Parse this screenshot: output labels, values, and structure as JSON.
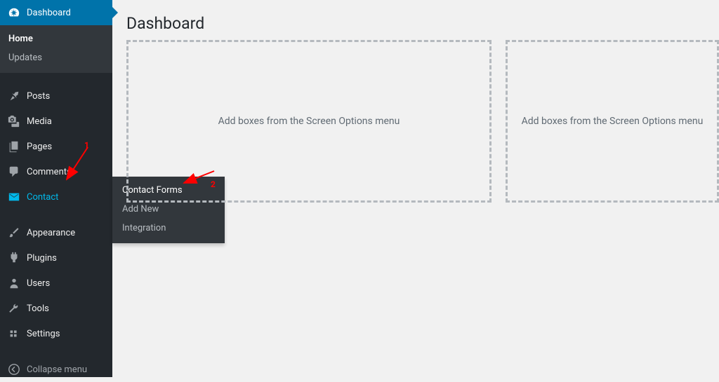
{
  "sidebar": {
    "dashboard": "Dashboard",
    "submenu": {
      "home": "Home",
      "updates": "Updates"
    },
    "posts": "Posts",
    "media": "Media",
    "pages": "Pages",
    "comments": "Comments",
    "contact": "Contact",
    "appearance": "Appearance",
    "plugins": "Plugins",
    "users": "Users",
    "tools": "Tools",
    "settings": "Settings",
    "collapse": "Collapse menu"
  },
  "flyout": {
    "contact_forms": "Contact Forms",
    "add_new": "Add New",
    "integration": "Integration"
  },
  "main": {
    "title": "Dashboard",
    "box_placeholder_1": "Add boxes from the Screen Options menu",
    "box_placeholder_2": "Add boxes from the Screen Options menu"
  },
  "annotations": {
    "one": "1",
    "two": "2"
  }
}
